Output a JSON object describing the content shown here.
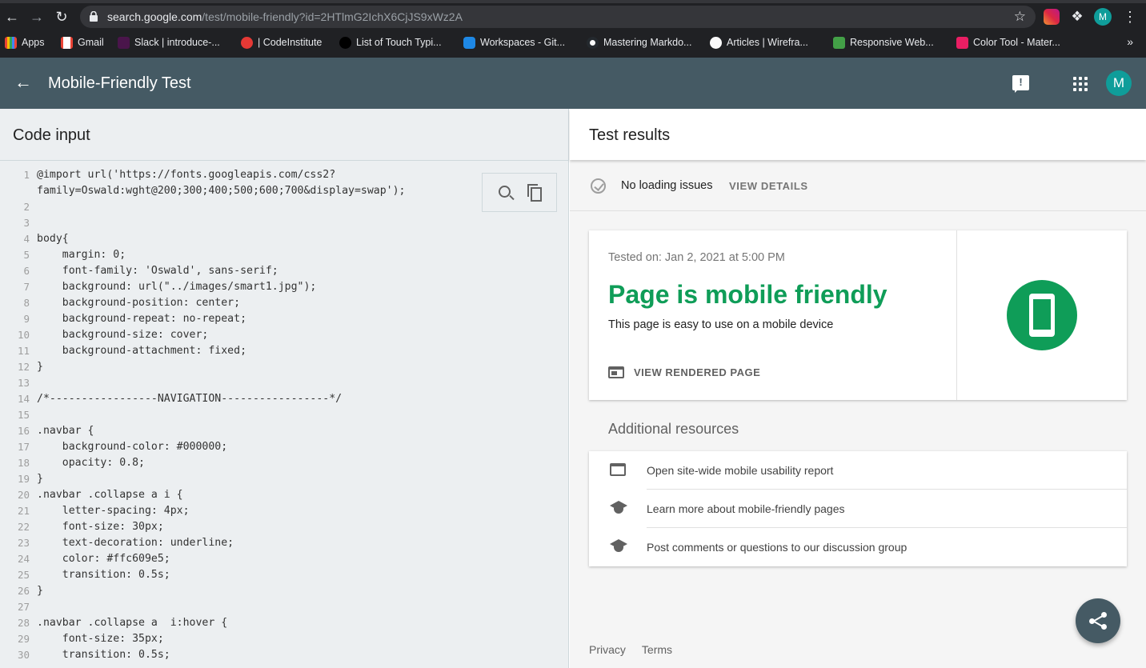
{
  "browser": {
    "url_host": "search.google.com",
    "url_path": "/test/mobile-friendly?id=2HTlmG2IchX6CjJS9xWz2A",
    "profile_initial": "M",
    "bookmarks": [
      {
        "label": "Apps",
        "color": "#ea4335"
      },
      {
        "label": "Gmail",
        "color": "#ea4335"
      },
      {
        "label": "Slack | introduce-...",
        "color": "#4a154b"
      },
      {
        "label": "| CodeInstitute",
        "color": "#e53935"
      },
      {
        "label": "List of Touch Typi...",
        "color": "#000000"
      },
      {
        "label": "Workspaces - Git...",
        "color": "#1e88e5"
      },
      {
        "label": "Mastering Markdo...",
        "color": "#24292e"
      },
      {
        "label": "Articles | Wirefra...",
        "color": "#fafafa"
      },
      {
        "label": "Responsive Web...",
        "color": "#43a047"
      },
      {
        "label": "Color Tool - Mater...",
        "color": "#e91e63"
      }
    ]
  },
  "appbar": {
    "title": "Mobile-Friendly Test",
    "account_initial": "M"
  },
  "code_panel": {
    "title": "Code input",
    "lines": [
      "@import url('https://fonts.googleapis.com/css2?",
      "family=Oswald:wght@200;300;400;500;600;700&display=swap');",
      "",
      "",
      "body{",
      "    margin: 0;",
      "    font-family: 'Oswald', sans-serif;",
      "    background: url(\"../images/smart1.jpg\");",
      "    background-position: center;",
      "    background-repeat: no-repeat;",
      "    background-size: cover;",
      "    background-attachment: fixed;",
      "}",
      "",
      "/*-----------------NAVIGATION-----------------*/",
      "",
      ".navbar {",
      "    background-color: #000000;",
      "    opacity: 0.8;",
      "}",
      ".navbar .collapse a i {",
      "    letter-spacing: 4px;",
      "    font-size: 30px;",
      "    text-decoration: underline;",
      "    color: #ffc609e5;",
      "    transition: 0.5s;",
      "}",
      "",
      ".navbar .collapse a  i:hover {",
      "    font-size: 35px;",
      "    transition: 0.5s;"
    ],
    "line_numbers": [
      "1",
      "",
      "2",
      "3",
      "4",
      "5",
      "6",
      "7",
      "8",
      "9",
      "10",
      "11",
      "12",
      "13",
      "14",
      "15",
      "16",
      "17",
      "18",
      "19",
      "20",
      "21",
      "22",
      "23",
      "24",
      "25",
      "26",
      "27",
      "28",
      "29",
      "30"
    ]
  },
  "results": {
    "title": "Test results",
    "loading_status": "No loading issues",
    "view_details": "VIEW DETAILS",
    "tested_on": "Tested on: Jan 2, 2021 at 5:00 PM",
    "verdict": "Page is mobile friendly",
    "verdict_sub": "This page is easy to use on a mobile device",
    "view_rendered": "VIEW RENDERED PAGE",
    "verdict_color": "#0f9d58",
    "additional_title": "Additional resources",
    "resources": [
      {
        "label": "Open site-wide mobile usability report",
        "icon": "window-icon"
      },
      {
        "label": "Learn more about mobile-friendly pages",
        "icon": "school-icon"
      },
      {
        "label": "Post comments or questions to our discussion group",
        "icon": "school-icon"
      }
    ],
    "footer": {
      "privacy": "Privacy",
      "terms": "Terms"
    }
  }
}
